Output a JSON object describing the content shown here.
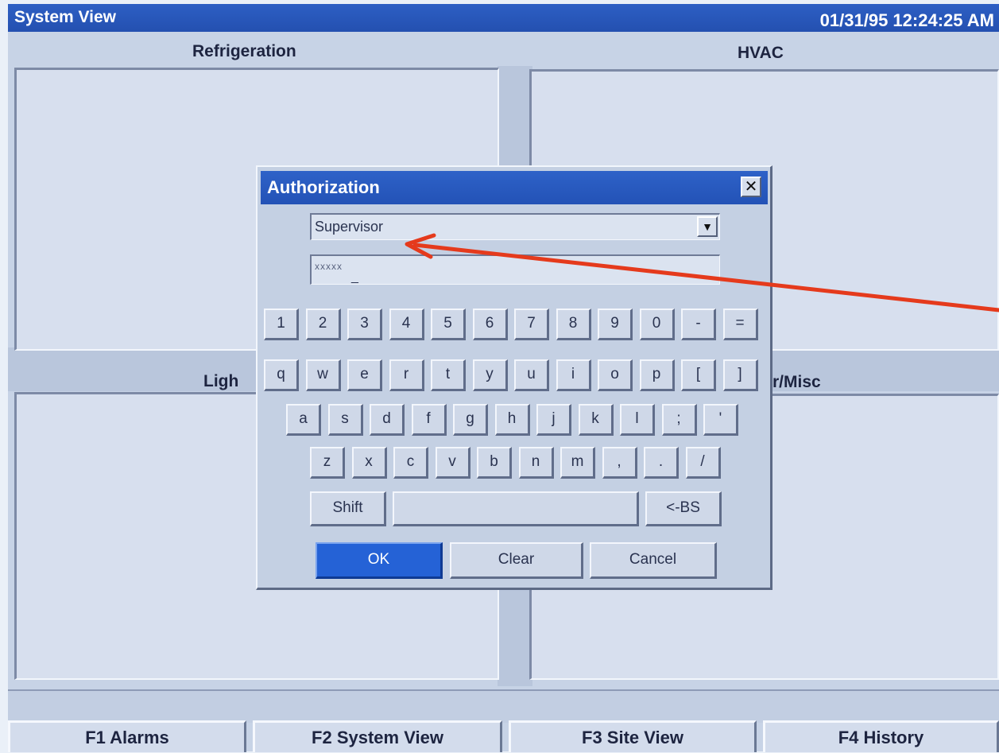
{
  "window": {
    "title": "System View",
    "datetime": "01/31/95 12:24:25 AM"
  },
  "sections": {
    "refrigeration": "Refrigeration",
    "hvac": "HVAC",
    "lighting_partial": "Ligh",
    "misc_partial": "r/Misc"
  },
  "dialog": {
    "title": "Authorization",
    "close_glyph": "✕",
    "user_select": "Supervisor",
    "dropdown_glyph": "▼",
    "password_mask": "xxxxx",
    "caret": "_",
    "keys": {
      "row1": [
        "1",
        "2",
        "3",
        "4",
        "5",
        "6",
        "7",
        "8",
        "9",
        "0",
        "-",
        "="
      ],
      "row2": [
        "q",
        "w",
        "e",
        "r",
        "t",
        "y",
        "u",
        "i",
        "o",
        "p",
        "[",
        "]"
      ],
      "row3": [
        "a",
        "s",
        "d",
        "f",
        "g",
        "h",
        "j",
        "k",
        "l",
        ";",
        "'"
      ],
      "row4": [
        "z",
        "x",
        "c",
        "v",
        "b",
        "n",
        "m",
        ",",
        ".",
        "/"
      ]
    },
    "shift_label": "Shift",
    "space_label": "",
    "backspace_label": "<-BS",
    "ok_label": "OK",
    "clear_label": "Clear",
    "cancel_label": "Cancel"
  },
  "function_keys": [
    "F1 Alarms",
    "F2 System View",
    "F3 Site View",
    "F4 History"
  ],
  "colors": {
    "title_blue": "#2d5fc4",
    "ok_blue": "#2562d6",
    "arrow_red": "#e53a1c",
    "panel": "#d7dfee"
  }
}
